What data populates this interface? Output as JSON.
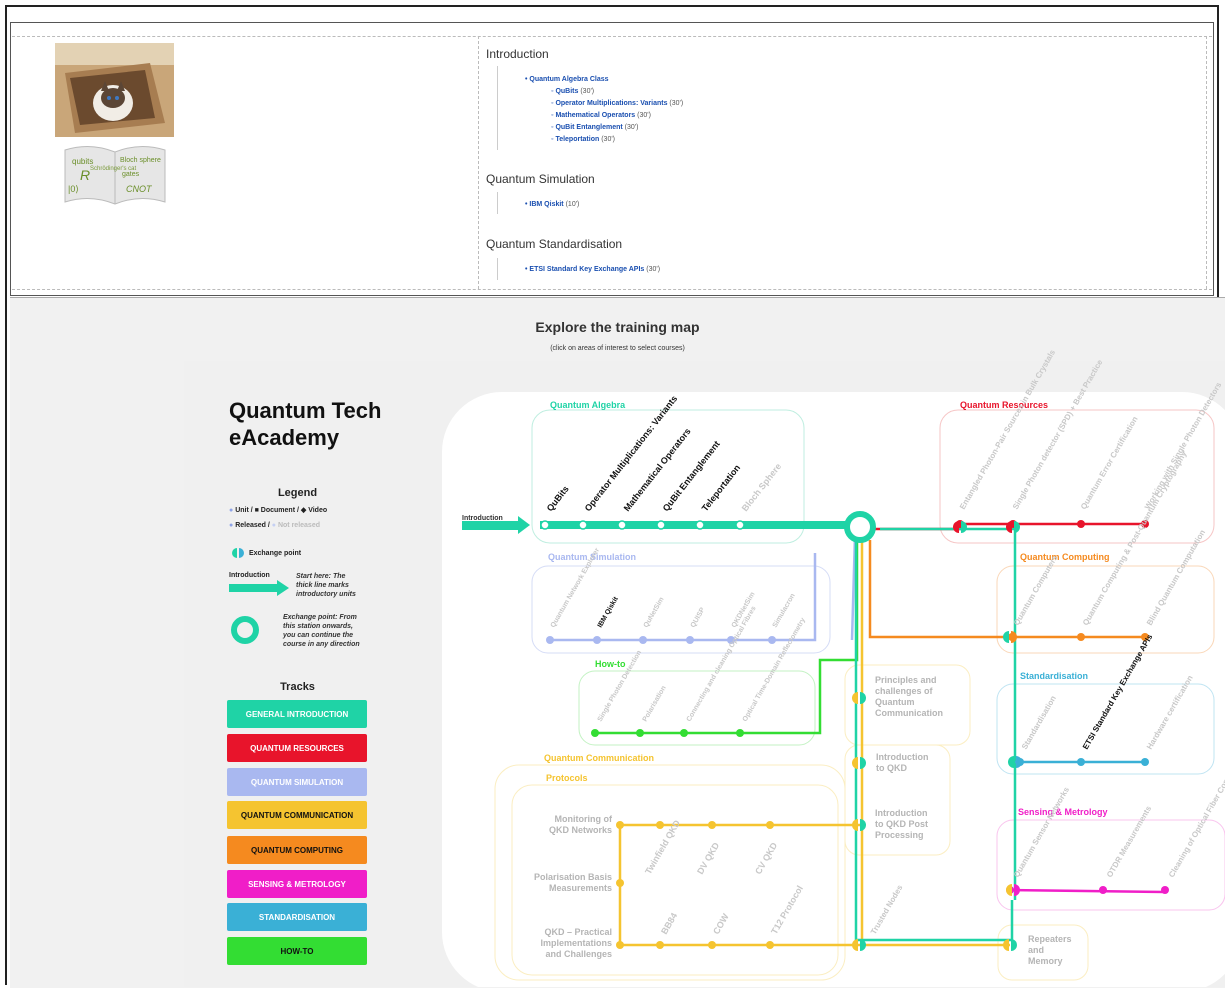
{
  "course_outline": {
    "sections": [
      {
        "title": "Introduction",
        "group": "Quantum Algebra Class",
        "items": [
          {
            "name": "QuBits",
            "dur": "(30')"
          },
          {
            "name": "Operator Multiplications: Variants",
            "dur": "(30')"
          },
          {
            "name": "Mathematical Operators",
            "dur": "(30')"
          },
          {
            "name": "QuBit Entanglement",
            "dur": "(30')"
          },
          {
            "name": "Teleportation",
            "dur": "(30')"
          }
        ]
      },
      {
        "title": "Quantum Simulation",
        "items": [
          {
            "name": "IBM Qiskit",
            "dur": "(10')"
          }
        ]
      },
      {
        "title": "Quantum Standardisation",
        "items": [
          {
            "name": "ETSI Standard Key Exchange APIs",
            "dur": "(30')"
          }
        ]
      }
    ]
  },
  "map": {
    "title": "Explore the training map",
    "subtitle": "(click on areas of interest to select courses)",
    "brand_line1": "Quantum Tech",
    "brand_line2": "eAcademy",
    "legend": {
      "title": "Legend",
      "row1": "Unit / ■ Document / ◆ Video",
      "row2a": "Released",
      "row2b": "Not released",
      "exchange": "Exchange point",
      "intro_label": "Introduction",
      "intro_note_1": "Start here: The",
      "intro_note_2": "thick line marks",
      "intro_note_3": "introductory units",
      "exch_note_1": "Exchange point: From",
      "exch_note_2": "this station onwards,",
      "exch_note_3": "you can continue the",
      "exch_note_4": "course in any direction"
    },
    "tracks_title": "Tracks",
    "tracks": [
      {
        "label": "GENERAL INTRODUCTION",
        "color": "#1fd3a6"
      },
      {
        "label": "QUANTUM RESOURCES",
        "color": "#e8142b"
      },
      {
        "label": "QUANTUM SIMULATION",
        "color": "#a9b8f0"
      },
      {
        "label": "QUANTUM COMMUNICATION",
        "color": "#f5c430"
      },
      {
        "label": "QUANTUM COMPUTING",
        "color": "#f58a1f"
      },
      {
        "label": "SENSING & METROLOGY",
        "color": "#f01ec8"
      },
      {
        "label": "STANDARDISATION",
        "color": "#3ab0d6"
      },
      {
        "label": "HOW-TO",
        "color": "#33dd33"
      }
    ],
    "areas": {
      "algebra": "Quantum Algebra",
      "resources": "Quantum Resources",
      "simulation": "Quantum Simulation",
      "computing": "Quantum Computing",
      "howto": "How-to",
      "standardisation": "Standardisation",
      "communication": "Quantum Communication",
      "protocols": "Protocols",
      "sensing": "Sensing & Metrology"
    },
    "intro_arrow": "Introduction",
    "stations": {
      "algebra": [
        "QuBits",
        "Operator Multiplications: Variants",
        "Mathematical Operators",
        "QuBit Entanglement",
        "Teleportation",
        "Bloch Sphere"
      ],
      "resources": [
        "Entangled Photon-Pair Sources in Bulk Crystals",
        "Single Photon detector (SPD) + Best Practice",
        "Quantum Error Certification",
        "Working with Single Photon Detectors"
      ],
      "simulation": [
        "Quantum Network Explorer",
        "IBM Qiskit",
        "QuNetSim",
        "QUISP",
        "QKDNetSim",
        "Simulacron"
      ],
      "computing": [
        "Quantum Computers",
        "Quantum Computing & Post-Quantum Cryptography",
        "Blind Quantum Computation"
      ],
      "howto": [
        "Single Photon Detection",
        "Polarisation",
        "Connecting and cleaning Optical Fibres",
        "Optical Time-Domain Reflectometry"
      ],
      "standardisation": [
        "Standardisation",
        "ETSI Standard Key Exchange APIs",
        "Hardware certification"
      ],
      "comm_core": [
        "Principles and challenges of Quantum Communication",
        "Introduction to QKD",
        "Introduction to QKD Post Processing",
        "Repeaters and Memory"
      ],
      "protocols_left": [
        "Monitoring of QKD Networks",
        "Polarisation Basis Measurements",
        "QKD – Practical Implementations and Challenges"
      ],
      "protocols_row1": [
        "Twinfield QKD",
        "DV QKD",
        "CV QKD"
      ],
      "protocols_row2": [
        "BB84",
        "COW",
        "T12 Protocol"
      ],
      "trusted": "Trusted Nodes",
      "sensing": [
        "Quantum Sensor Networks",
        "OTDR Measurements",
        "Cleaning of Optical Fiber Connectors"
      ]
    }
  }
}
